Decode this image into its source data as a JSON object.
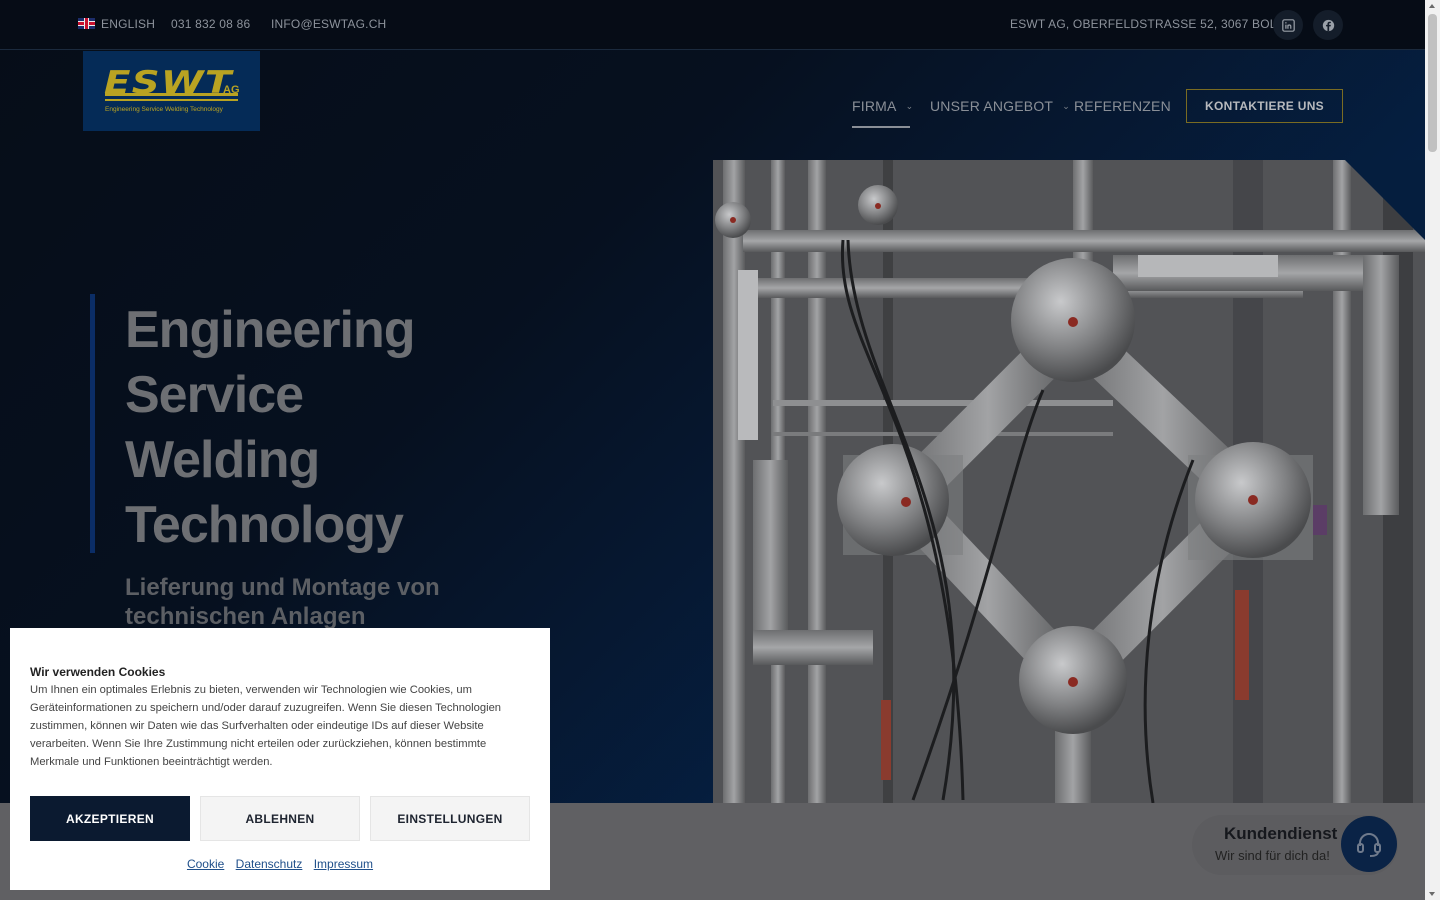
{
  "topbar": {
    "language": "ENGLISH",
    "phone": "031 832 08 86",
    "email": "INFO@ESWTAG.CH",
    "address": "ESWT AG, OBERFELDSTRASSE 52, 3067 BOLL",
    "social": [
      "linkedin-icon",
      "facebook-icon"
    ]
  },
  "logo": {
    "wordmark": "ESWT",
    "suffix": "AG",
    "tagline": "Engineering Service Welding Technology"
  },
  "nav": {
    "items": [
      {
        "label": "FIRMA",
        "active": true
      },
      {
        "label": "UNSER ANGEBOT"
      },
      {
        "label": "REFERENZEN"
      }
    ],
    "cta": "KONTAKTIERE UNS"
  },
  "hero": {
    "title": "Engineering Service Welding Technology",
    "subtitle": "Lieferung und Montage von technischen Anlagen"
  },
  "cookie": {
    "title": "Wir verwenden Cookies",
    "body": "Um Ihnen ein optimales Erlebnis zu bieten, verwenden wir Technologien wie Cookies, um Geräteinformationen zu speichern und/oder darauf zuzugreifen. Wenn Sie diesen Technologien zustimmen, können wir Daten wie das Surfverhalten oder eindeutige IDs auf dieser Website verarbeiten. Wenn Sie Ihre Zustimmung nicht erteilen oder zurückziehen, können bestimmte Merkmale und Funktionen beeinträchtigt werden.",
    "accept": "AKZEPTIEREN",
    "decline": "ABLEHNEN",
    "settings": "EINSTELLUNGEN",
    "links": [
      "Cookie",
      "Datenschutz",
      "Impressum"
    ]
  },
  "support": {
    "title": "Kundendienst",
    "subtitle": "Wir sind für dich da!"
  },
  "colors": {
    "accent_gold": "#b9a322",
    "navy": "#0b1a30",
    "hero_bar": "#0b2d66"
  }
}
